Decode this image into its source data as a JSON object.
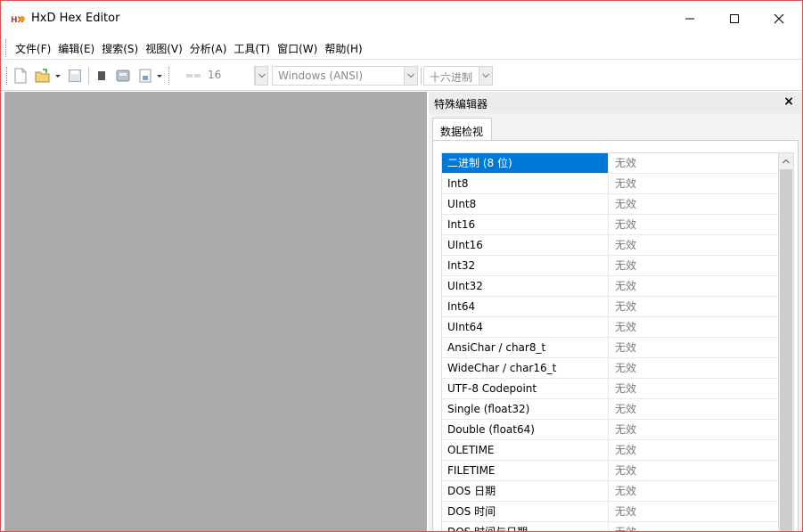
{
  "window": {
    "title": "HxD Hex Editor",
    "accent_color": "#0078d7",
    "border_color": "#d9534f"
  },
  "title_buttons": {
    "minimize_icon": "minimize-icon",
    "maximize_icon": "maximize-icon",
    "close_icon": "close-icon"
  },
  "menu": [
    {
      "label": "文件(F)"
    },
    {
      "label": "编辑(E)"
    },
    {
      "label": "搜索(S)"
    },
    {
      "label": "视图(V)"
    },
    {
      "label": "分析(A)"
    },
    {
      "label": "工具(T)"
    },
    {
      "label": "窗口(W)"
    },
    {
      "label": "帮助(H)"
    }
  ],
  "toolbar": {
    "bytes_per_row": "16",
    "charset": "Windows (ANSI)",
    "offset_base": "十六进制"
  },
  "special_editor": {
    "title": "特殊编辑器",
    "close_label": "×",
    "tab_label": "数据检视",
    "rows": [
      {
        "name": "二进制 (8 位)",
        "value": "无效"
      },
      {
        "name": "Int8",
        "value": "无效"
      },
      {
        "name": "UInt8",
        "value": "无效"
      },
      {
        "name": "Int16",
        "value": "无效"
      },
      {
        "name": "UInt16",
        "value": "无效"
      },
      {
        "name": "Int32",
        "value": "无效"
      },
      {
        "name": "UInt32",
        "value": "无效"
      },
      {
        "name": "Int64",
        "value": "无效"
      },
      {
        "name": "UInt64",
        "value": "无效"
      },
      {
        "name": "AnsiChar / char8_t",
        "value": "无效"
      },
      {
        "name": "WideChar / char16_t",
        "value": "无效"
      },
      {
        "name": "UTF-8 Codepoint",
        "value": "无效"
      },
      {
        "name": "Single (float32)",
        "value": "无效"
      },
      {
        "name": "Double (float64)",
        "value": "无效"
      },
      {
        "name": "OLETIME",
        "value": "无效"
      },
      {
        "name": "FILETIME",
        "value": "无效"
      },
      {
        "name": "DOS 日期",
        "value": "无效"
      },
      {
        "name": "DOS 时间",
        "value": "无效"
      },
      {
        "name": "DOS 时间与日期",
        "value": "无效"
      }
    ]
  }
}
